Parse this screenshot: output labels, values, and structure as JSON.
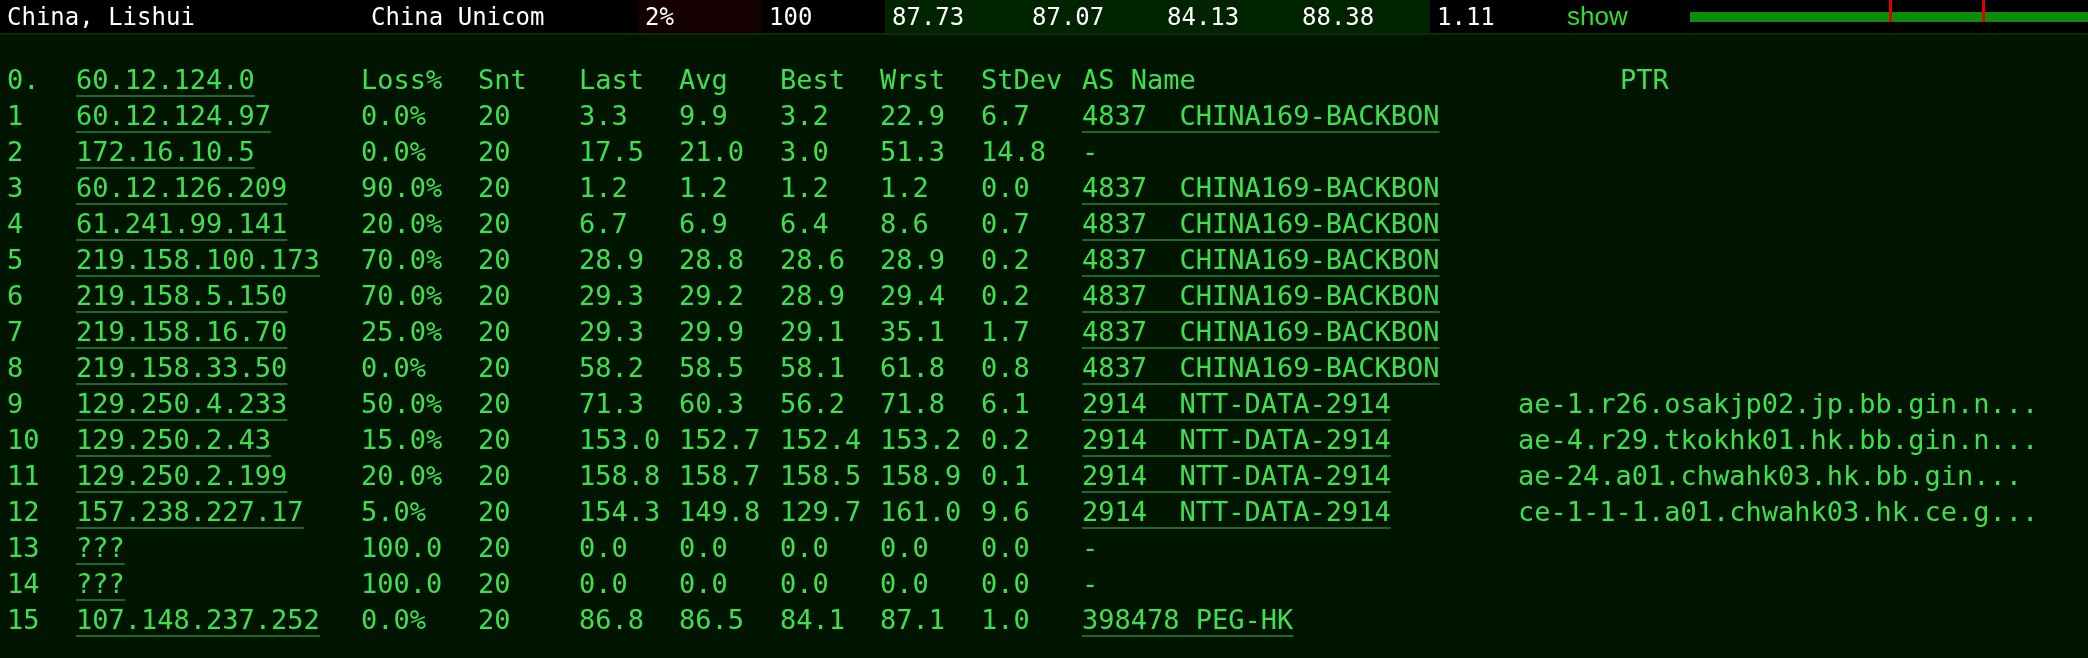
{
  "summary": {
    "location": "China, Lishui",
    "isp": "China Unicom",
    "loss": "2%",
    "sent": "100",
    "last": "87.73",
    "avg": "87.07",
    "best": "84.13",
    "worst": "88.38",
    "stdev": "1.11",
    "action": "show"
  },
  "table": {
    "header": {
      "hop": "0.",
      "host": "60.12.124.0",
      "columns": [
        "Loss%",
        "Snt",
        "Last",
        "Avg",
        "Best",
        "Wrst",
        "StDev",
        "AS Name",
        "PTR"
      ]
    },
    "rows": [
      {
        "hop": "1",
        "host": "60.12.124.97",
        "loss": "0.0%",
        "snt": "20",
        "last": "3.3",
        "avg": "9.9",
        "best": "3.2",
        "wrst": "22.9",
        "stdev": "6.7",
        "as": {
          "text": "4837  CHINA169-BACKBON",
          "link": true
        }
      },
      {
        "hop": "2",
        "host": "172.16.10.5",
        "loss": "0.0%",
        "snt": "20",
        "last": "17.5",
        "avg": "21.0",
        "best": "3.0",
        "wrst": "51.3",
        "stdev": "14.8",
        "as": {
          "text": "-",
          "link": false
        }
      },
      {
        "hop": "3",
        "host": "60.12.126.209",
        "loss": "90.0%",
        "snt": "20",
        "last": "1.2",
        "avg": "1.2",
        "best": "1.2",
        "wrst": "1.2",
        "stdev": "0.0",
        "as": {
          "text": "4837  CHINA169-BACKBON",
          "link": true
        }
      },
      {
        "hop": "4",
        "host": "61.241.99.141",
        "loss": "20.0%",
        "snt": "20",
        "last": "6.7",
        "avg": "6.9",
        "best": "6.4",
        "wrst": "8.6",
        "stdev": "0.7",
        "as": {
          "text": "4837  CHINA169-BACKBON",
          "link": true
        }
      },
      {
        "hop": "5",
        "host": "219.158.100.173",
        "loss": "70.0%",
        "snt": "20",
        "last": "28.9",
        "avg": "28.8",
        "best": "28.6",
        "wrst": "28.9",
        "stdev": "0.2",
        "as": {
          "text": "4837  CHINA169-BACKBON",
          "link": true
        }
      },
      {
        "hop": "6",
        "host": "219.158.5.150",
        "loss": "70.0%",
        "snt": "20",
        "last": "29.3",
        "avg": "29.2",
        "best": "28.9",
        "wrst": "29.4",
        "stdev": "0.2",
        "as": {
          "text": "4837  CHINA169-BACKBON",
          "link": true
        }
      },
      {
        "hop": "7",
        "host": "219.158.16.70",
        "loss": "25.0%",
        "snt": "20",
        "last": "29.3",
        "avg": "29.9",
        "best": "29.1",
        "wrst": "35.1",
        "stdev": "1.7",
        "as": {
          "text": "4837  CHINA169-BACKBON",
          "link": true
        }
      },
      {
        "hop": "8",
        "host": "219.158.33.50",
        "loss": "0.0%",
        "snt": "20",
        "last": "58.2",
        "avg": "58.5",
        "best": "58.1",
        "wrst": "61.8",
        "stdev": "0.8",
        "as": {
          "text": "4837  CHINA169-BACKBON",
          "link": true
        }
      },
      {
        "hop": "9",
        "host": "129.250.4.233",
        "loss": "50.0%",
        "snt": "20",
        "last": "71.3",
        "avg": "60.3",
        "best": "56.2",
        "wrst": "71.8",
        "stdev": "6.1",
        "as": {
          "text": "2914  NTT-DATA-2914",
          "link": true
        },
        "ptr": "ae-1.r26.osakjp02.jp.bb.gin.n..."
      },
      {
        "hop": "10",
        "host": "129.250.2.43",
        "loss": "15.0%",
        "snt": "20",
        "last": "153.0",
        "avg": "152.7",
        "best": "152.4",
        "wrst": "153.2",
        "stdev": "0.2",
        "as": {
          "text": "2914  NTT-DATA-2914",
          "link": true
        },
        "ptr": "ae-4.r29.tkokhk01.hk.bb.gin.n..."
      },
      {
        "hop": "11",
        "host": "129.250.2.199",
        "loss": "20.0%",
        "snt": "20",
        "last": "158.8",
        "avg": "158.7",
        "best": "158.5",
        "wrst": "158.9",
        "stdev": "0.1",
        "as": {
          "text": "2914  NTT-DATA-2914",
          "link": true
        },
        "ptr": "ae-24.a01.chwahk03.hk.bb.gin..."
      },
      {
        "hop": "12",
        "host": "157.238.227.17",
        "loss": "5.0%",
        "snt": "20",
        "last": "154.3",
        "avg": "149.8",
        "best": "129.7",
        "wrst": "161.0",
        "stdev": "9.6",
        "as": {
          "text": "2914  NTT-DATA-2914",
          "link": true
        },
        "ptr": "ce-1-1-1.a01.chwahk03.hk.ce.g..."
      },
      {
        "hop": "13",
        "host": "???",
        "loss": "100.0",
        "snt": "20",
        "last": "0.0",
        "avg": "0.0",
        "best": "0.0",
        "wrst": "0.0",
        "stdev": "0.0",
        "as": {
          "text": "-",
          "link": false
        }
      },
      {
        "hop": "14",
        "host": "???",
        "loss": "100.0",
        "snt": "20",
        "last": "0.0",
        "avg": "0.0",
        "best": "0.0",
        "wrst": "0.0",
        "stdev": "0.0",
        "as": {
          "text": "-",
          "link": false
        }
      },
      {
        "hop": "15",
        "host": "107.148.237.252",
        "loss": "0.0%",
        "snt": "20",
        "last": "86.8",
        "avg": "86.5",
        "best": "84.1",
        "wrst": "87.1",
        "stdev": "1.0",
        "as": {
          "text": "398478 PEG-HK",
          "link": true
        }
      }
    ]
  }
}
